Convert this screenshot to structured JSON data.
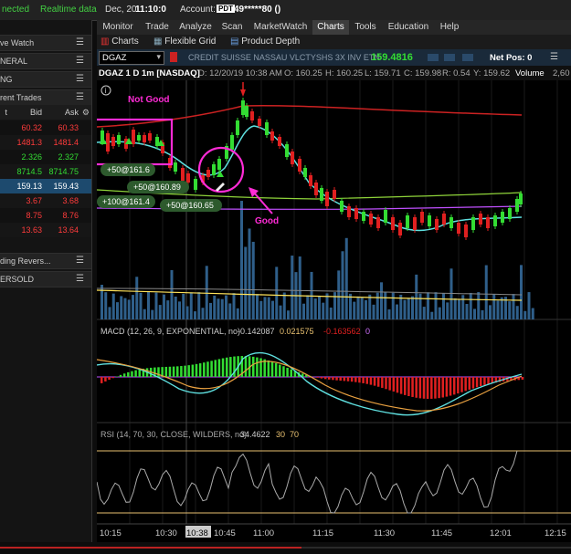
{
  "status_bar": {
    "connection": "nected",
    "data_mode": "Realtime data",
    "date": "Dec, 20",
    "time": "11:10:0",
    "account_label": "Account:",
    "account_tag": "PDT",
    "account_number": "49*****80 ()"
  },
  "left_panel": {
    "watch_header": "ve Watch",
    "sections": [
      "NERAL",
      "NG",
      "rent Trades"
    ],
    "columns": [
      "t",
      "Bid",
      "Ask"
    ],
    "rows": [
      {
        "bid": "60.32",
        "ask": "60.33",
        "color": "#ff3b3b"
      },
      {
        "bid": "1481.3",
        "ask": "1481.4",
        "color": "#ff3b3b"
      },
      {
        "bid": "2.326",
        "ask": "2.327",
        "color": "#33dd33"
      },
      {
        "bid": "8714.5",
        "ask": "8714.75",
        "color": "#33dd33"
      },
      {
        "bid": "159.13",
        "ask": "159.43",
        "color": "#ffffff",
        "highlight": true
      },
      {
        "bid": "3.67",
        "ask": "3.68",
        "color": "#ff3b3b"
      },
      {
        "bid": "8.75",
        "ask": "8.76",
        "color": "#ff3b3b"
      },
      {
        "bid": "13.63",
        "ask": "13.64",
        "color": "#ff3b3b"
      }
    ],
    "scanner_items": [
      "ding Revers...",
      "ERSOLD"
    ]
  },
  "menu": {
    "items": [
      "Monitor",
      "Trade",
      "Analyze",
      "Scan",
      "MarketWatch",
      "Charts",
      "Tools",
      "Education",
      "Help"
    ],
    "active": "Charts"
  },
  "subtabs": [
    "Charts",
    "Flexible Grid",
    "Product Depth"
  ],
  "symbol_bar": {
    "symbol": "DGAZ",
    "description": "CREDIT SUISSE NASSAU VLCTYSHS 3X INV ETN",
    "price": "159.4816",
    "net_pos_label": "Net Pos: 0"
  },
  "price_info": {
    "title": "DGAZ 1 D 1m [NASDAQ]",
    "date": "D: 12/20/19 10:38 AM",
    "open": "O: 160.25",
    "high": "H: 160.25",
    "low": "L: 159.71",
    "close": "C: 159.98",
    "range": "R: 0.54",
    "y": "Y: 159.62",
    "volume": "Volume",
    "volume_value": "2,60"
  },
  "annotations": {
    "not_good": "Not Good",
    "good": "Good",
    "fills": [
      "+50@161.6",
      "+50@160.89",
      "+100@161.4",
      "+50@160.65"
    ]
  },
  "macd": {
    "label": "MACD (12, 26, 9, EXPONENTIAL, no)",
    "value": "-0.142087",
    "avg": "0.021575",
    "diff": "-0.163562",
    "zero": "0"
  },
  "rsi": {
    "label": "RSI (14, 70, 30, CLOSE, WILDERS, no)",
    "value": "34.4622",
    "oversold": "30",
    "overbought": "70"
  },
  "time_axis": [
    "10:15",
    "10:30",
    "10:38",
    "10:45",
    "11:00",
    "11:15",
    "11:30",
    "11:45",
    "12:01",
    "12:15"
  ],
  "colors": {
    "up": "#33dd33",
    "down": "#e02020",
    "highlight": "#ff2bd6",
    "cyan": "#5fe0e0",
    "volume": "#2f5f8a"
  }
}
